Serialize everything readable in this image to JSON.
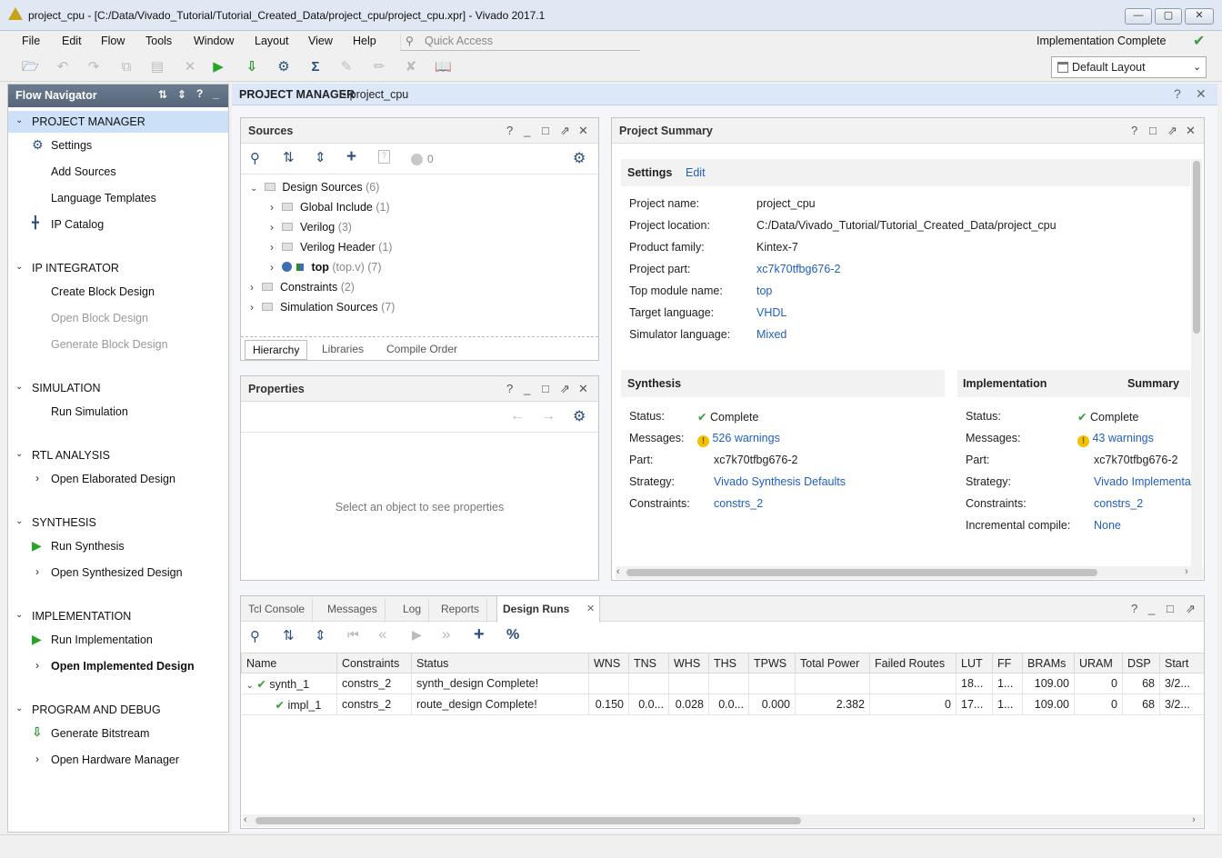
{
  "window": {
    "title": "project_cpu - [C:/Data/Vivado_Tutorial/Tutorial_Created_Data/project_cpu/project_cpu.xpr] - Vivado 2017.1",
    "min_icon": "minimize-icon",
    "max_icon": "maximize-icon",
    "close_icon": "close-icon"
  },
  "menu": {
    "items": [
      "File",
      "Edit",
      "Flow",
      "Tools",
      "Window",
      "Layout",
      "View",
      "Help"
    ],
    "quick_access_placeholder": "Quick Access",
    "status": "Implementation Complete",
    "layout_select": "Default Layout"
  },
  "flow_nav": {
    "title": "Flow Navigator",
    "sections": [
      {
        "label": "PROJECT MANAGER",
        "items": [
          "Settings",
          "Add Sources",
          "Language Templates",
          "IP Catalog"
        ]
      },
      {
        "label": "IP INTEGRATOR",
        "items": [
          "Create Block Design",
          "Open Block Design",
          "Generate Block Design"
        ]
      },
      {
        "label": "SIMULATION",
        "items": [
          "Run Simulation"
        ]
      },
      {
        "label": "RTL ANALYSIS",
        "items": [
          "Open Elaborated Design"
        ]
      },
      {
        "label": "SYNTHESIS",
        "items": [
          "Run Synthesis",
          "Open Synthesized Design"
        ]
      },
      {
        "label": "IMPLEMENTATION",
        "items": [
          "Run Implementation",
          "Open Implemented Design"
        ]
      },
      {
        "label": "PROGRAM AND DEBUG",
        "items": [
          "Generate Bitstream",
          "Open Hardware Manager"
        ]
      }
    ]
  },
  "main_header": {
    "title": "PROJECT MANAGER",
    "subtitle": " - project_cpu"
  },
  "sources": {
    "title": "Sources",
    "badge_count": "0",
    "tree": [
      {
        "label": "Design Sources",
        "count": "(6)"
      },
      {
        "label": "Global Include",
        "count": "(1)"
      },
      {
        "label": "Verilog",
        "count": "(3)"
      },
      {
        "label": "Verilog Header",
        "count": "(1)"
      },
      {
        "label": "top",
        "count": "(top.v) (7)"
      },
      {
        "label": "Constraints",
        "count": "(2)"
      },
      {
        "label": "Simulation Sources",
        "count": "(7)"
      }
    ],
    "tabs": [
      "Hierarchy",
      "Libraries",
      "Compile Order"
    ]
  },
  "properties": {
    "title": "Properties",
    "empty_text": "Select an object to see properties"
  },
  "summary": {
    "title": "Project Summary",
    "settings_label": "Settings",
    "edit_label": "Edit",
    "rows": [
      {
        "k": "Project name:",
        "v": "project_cpu"
      },
      {
        "k": "Project location:",
        "v": "C:/Data/Vivado_Tutorial/Tutorial_Created_Data/project_cpu"
      },
      {
        "k": "Product family:",
        "v": "Kintex-7"
      },
      {
        "k": "Project part:",
        "v": "xc7k70tfbg676-2"
      },
      {
        "k": "Top module name:",
        "v": "top"
      },
      {
        "k": "Target language:",
        "v": "VHDL"
      },
      {
        "k": "Simulator language:",
        "v": "Mixed"
      }
    ],
    "synthesis": {
      "title": "Synthesis",
      "rows": [
        {
          "k": "Status:",
          "v": "Complete"
        },
        {
          "k": "Messages:",
          "v": "526 warnings"
        },
        {
          "k": "Part:",
          "v": "xc7k70tfbg676-2"
        },
        {
          "k": "Strategy:",
          "v": "Vivado Synthesis Defaults"
        },
        {
          "k": "Constraints:",
          "v": "constrs_2"
        }
      ]
    },
    "implementation": {
      "title": "Implementation",
      "summary_label": "Summary",
      "rows": [
        {
          "k": "Status:",
          "v": "Complete"
        },
        {
          "k": "Messages:",
          "v": "43 warnings"
        },
        {
          "k": "Part:",
          "v": "xc7k70tfbg676-2"
        },
        {
          "k": "Strategy:",
          "v": "Vivado Implementatio"
        },
        {
          "k": "Constraints:",
          "v": "constrs_2"
        },
        {
          "k": "Incremental compile:",
          "v": "None"
        }
      ]
    }
  },
  "bottom": {
    "tabs": [
      "Tcl Console",
      "Messages",
      "Log",
      "Reports",
      "Design Runs"
    ],
    "columns": [
      "Name",
      "Constraints",
      "Status",
      "WNS",
      "TNS",
      "WHS",
      "THS",
      "TPWS",
      "Total Power",
      "Failed Routes",
      "LUT",
      "FF",
      "BRAMs",
      "URAM",
      "DSP",
      "Start"
    ],
    "rows": [
      [
        "synth_1",
        "constrs_2",
        "synth_design Complete!",
        "",
        "",
        "",
        "",
        "",
        "",
        "",
        "18...",
        "1...",
        "109.00",
        "0",
        "68",
        "3/2..."
      ],
      [
        "impl_1",
        "constrs_2",
        "route_design Complete!",
        "0.150",
        "0.0...",
        "0.028",
        "0.0...",
        "0.000",
        "2.382",
        "0",
        "17...",
        "1...",
        "109.00",
        "0",
        "68",
        "3/2..."
      ]
    ]
  }
}
